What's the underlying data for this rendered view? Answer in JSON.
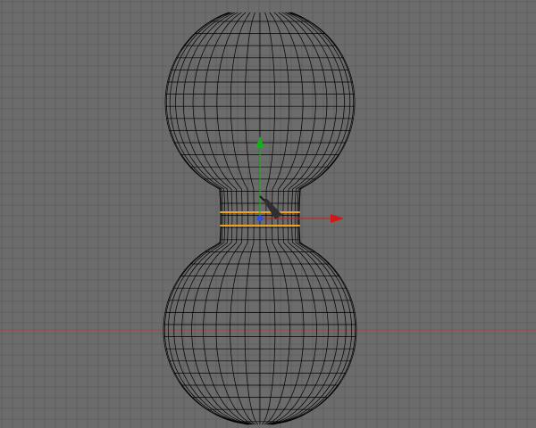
{
  "viewport": {
    "view": "front-orthographic",
    "background_color": "#6c6c6c",
    "grid_color": "#5f5f5f",
    "world_x_axis_color": "#b04040"
  },
  "mesh": {
    "shape": "peanut",
    "wire_color": "#000000",
    "selected_edge_loops": 2,
    "selection_color": "#f0a020"
  },
  "gizmo": {
    "x_axis_color": "#d01818",
    "y_axis_color": "#18b018",
    "z_axis_color": "#3050e0"
  },
  "tools": {
    "cursor_icon": "knife-icon"
  }
}
